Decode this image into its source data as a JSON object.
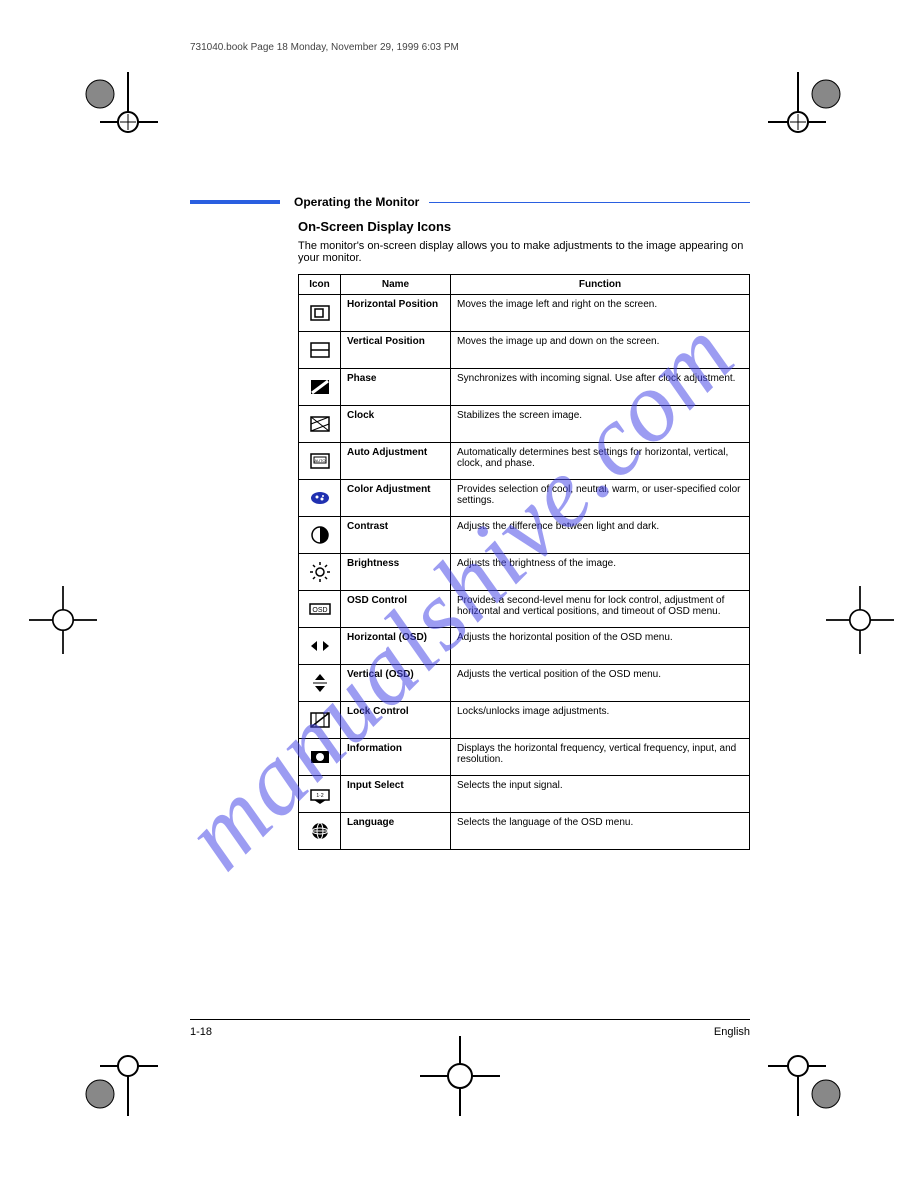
{
  "book_label": "731040.book  Page 18  Monday, November 29, 1999  6:03 PM",
  "watermark": "manualshive.com",
  "header_title": "Operating the Monitor",
  "section_title": "On-Screen Display Icons",
  "section_intro": "The monitor's on-screen display allows you to make adjustments to the image appearing on your monitor.",
  "table": {
    "headers": [
      "Icon",
      "Name",
      "Function"
    ],
    "rows": [
      {
        "icon": "hpos",
        "name": "Horizontal Position",
        "desc": "Moves the image left and right on the screen."
      },
      {
        "icon": "vpos",
        "name": "Vertical Position",
        "desc": "Moves the image up and down on the screen."
      },
      {
        "icon": "phase",
        "name": "Phase",
        "desc": "Synchronizes with incoming signal. Use after clock adjustment."
      },
      {
        "icon": "clock",
        "name": "Clock",
        "desc": "Stabilizes the screen image."
      },
      {
        "icon": "auto",
        "name": "Auto Adjustment",
        "desc": "Automatically determines best settings for horizontal, vertical, clock, and phase."
      },
      {
        "icon": "color",
        "name": "Color Adjustment",
        "desc": "Provides selection of cool, neutral, warm, or user-specified color settings."
      },
      {
        "icon": "contrast",
        "name": "Contrast",
        "desc": "Adjusts the difference between light and dark."
      },
      {
        "icon": "bright",
        "name": "Brightness",
        "desc": "Adjusts the brightness of the image."
      },
      {
        "icon": "osd",
        "name": "OSD Control",
        "desc": "Provides a second-level menu for lock control, adjustment of horizontal and vertical positions, and timeout of OSD menu."
      },
      {
        "icon": "hosd",
        "name": "Horizontal (OSD)",
        "desc": "Adjusts the horizontal position of the OSD menu."
      },
      {
        "icon": "vosd",
        "name": "Vertical (OSD)",
        "desc": "Adjusts the vertical position of the OSD menu."
      },
      {
        "icon": "lock",
        "name": "Lock Control",
        "desc": "Locks/unlocks image adjustments."
      },
      {
        "icon": "info",
        "name": "Information",
        "desc": "Displays the horizontal frequency, vertical frequency, input, and resolution."
      },
      {
        "icon": "input",
        "name": "Input Select",
        "desc": "Selects the input signal."
      },
      {
        "icon": "lang",
        "name": "Language",
        "desc": "Selects the language of the OSD menu."
      }
    ]
  },
  "footer": {
    "left": "1-18",
    "right": "English"
  }
}
